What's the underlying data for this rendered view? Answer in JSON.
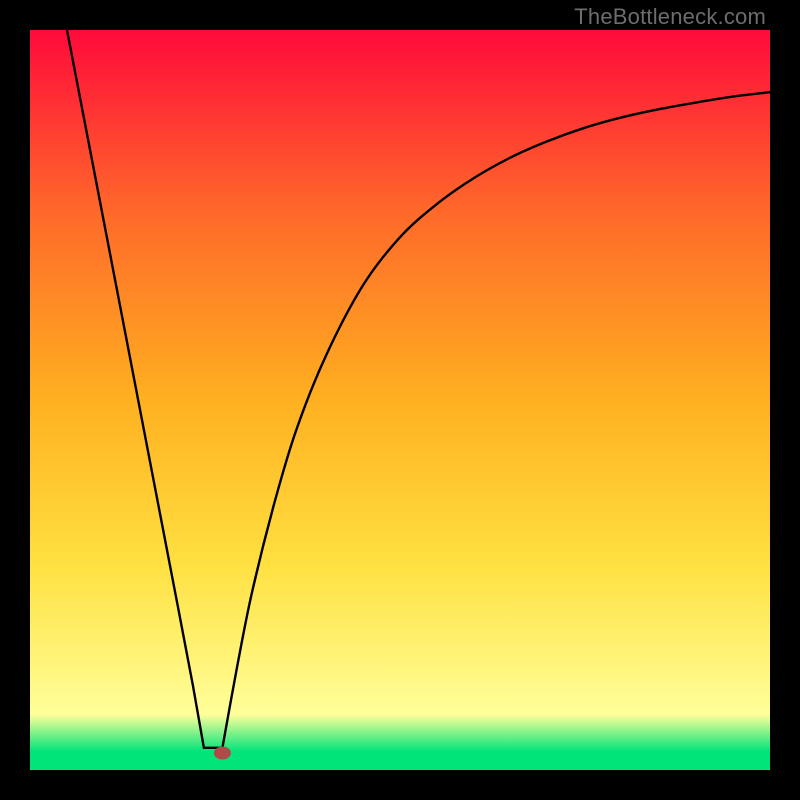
{
  "watermark": "TheBottleneck.com",
  "colors": {
    "top": "#ff0a3a",
    "upper_mid": "#ff6a2a",
    "mid": "#ffb020",
    "lower_mid": "#ffe040",
    "pale_yellow": "#ffff9a",
    "green": "#00e47a",
    "curve": "#000000",
    "dot_fill": "#b04948",
    "dot_stroke": "#b04948"
  },
  "chart_data": {
    "type": "line",
    "title": "",
    "xlabel": "",
    "ylabel": "",
    "xlim": [
      0,
      100
    ],
    "ylim": [
      0,
      100
    ],
    "series": [
      {
        "name": "left-branch",
        "x": [
          5,
          10,
          15,
          20,
          22,
          23.5
        ],
        "values": [
          100,
          74,
          48,
          22,
          11.5,
          3
        ]
      },
      {
        "name": "right-branch",
        "x": [
          26,
          28,
          30,
          33,
          36,
          40,
          45,
          50,
          55,
          60,
          65,
          70,
          75,
          80,
          85,
          90,
          95,
          100
        ],
        "values": [
          3,
          14,
          24,
          36,
          46,
          56,
          65.5,
          72,
          76.5,
          80,
          82.8,
          85,
          86.8,
          88.2,
          89.3,
          90.2,
          91,
          91.6
        ]
      }
    ],
    "flat_segment": {
      "x": [
        23.5,
        26
      ],
      "y": 3
    },
    "marker": {
      "x": 26,
      "y": 2.3
    },
    "gradient_stops": [
      {
        "offset": 0.0,
        "color_key": "top"
      },
      {
        "offset": 0.25,
        "color_key": "upper_mid"
      },
      {
        "offset": 0.5,
        "color_key": "mid"
      },
      {
        "offset": 0.72,
        "color_key": "lower_mid"
      },
      {
        "offset": 0.925,
        "color_key": "pale_yellow"
      },
      {
        "offset": 0.975,
        "color_key": "green"
      },
      {
        "offset": 1.0,
        "color_key": "green"
      }
    ]
  }
}
